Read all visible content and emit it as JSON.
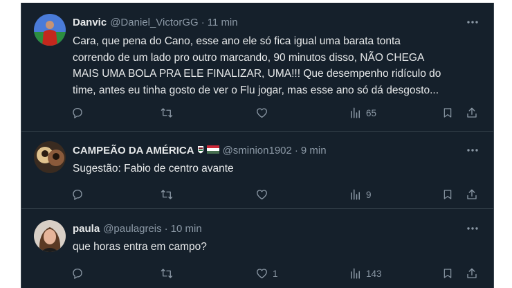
{
  "tweets": [
    {
      "name": "Danvic",
      "handle": "@Daniel_VictorGG",
      "separator": "·",
      "time": "11 min",
      "lines": [
        "Cara, que pena do Cano, esse ano ele só fica igual uma barata tonta",
        "correndo de um lado pro outro marcando, 90 minutos disso, NÃO CHEGA",
        "MAIS UMA BOLA PRA ELE FINALIZAR, UMA!!! Que desempenho ridículo do",
        "time, antes eu tinha gosto de ver o Flu jogar, mas esse ano só dá desgosto..."
      ],
      "replies": "",
      "retweets": "",
      "likes": "",
      "views": "65"
    },
    {
      "name": "CAMPEÃO DA AMÉRICA",
      "flag_icons": [
        "flu-crest-icon",
        "hungary-flag-icon"
      ],
      "handle": "@sminion1902",
      "separator": "·",
      "time": "9 min",
      "lines": [
        "Sugestão: Fabio de centro avante"
      ],
      "replies": "",
      "retweets": "",
      "likes": "",
      "views": "9"
    },
    {
      "name": "paula",
      "handle": "@paulagreis",
      "separator": "·",
      "time": "10 min",
      "lines": [
        "que horas entra em campo?"
      ],
      "replies": "",
      "retweets": "",
      "likes": "1",
      "views": "143"
    }
  ],
  "theme": {
    "background": "#15202b",
    "border": "#38444d",
    "primary_text": "#e7e9ea",
    "secondary_text": "#8b98a5"
  }
}
